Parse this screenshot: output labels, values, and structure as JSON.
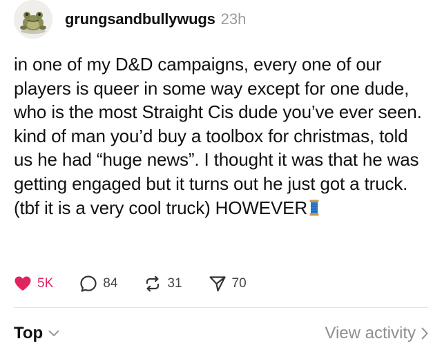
{
  "post": {
    "author": "grungsandbullywugs",
    "timestamp": "23h",
    "body": "in one of my D&D campaigns, every one of our players is queer in some way except for one dude, who is the most Straight Cis dude you’ve ever seen. kind of man you’d buy a toolbox for christmas, told us he had “huge news”. I thought it was that he was getting engaged but it turns out he just got a truck. (tbf it is a very cool truck) HOWEVER",
    "emoji": "spool-of-thread"
  },
  "actions": {
    "likes": "5K",
    "replies": "84",
    "reposts": "31",
    "shares": "70"
  },
  "footer": {
    "sort_label": "Top",
    "activity_label": "View activity"
  },
  "icons": {
    "like": "heart-icon",
    "reply": "comment-bubble-icon",
    "repost": "repost-arrows-icon",
    "share": "send-icon",
    "sort": "chevron-down-icon",
    "activity": "chevron-right-icon"
  },
  "colors": {
    "like_active": "#e0245e",
    "muted_text": "#8e8e8e",
    "text": "#111111"
  }
}
